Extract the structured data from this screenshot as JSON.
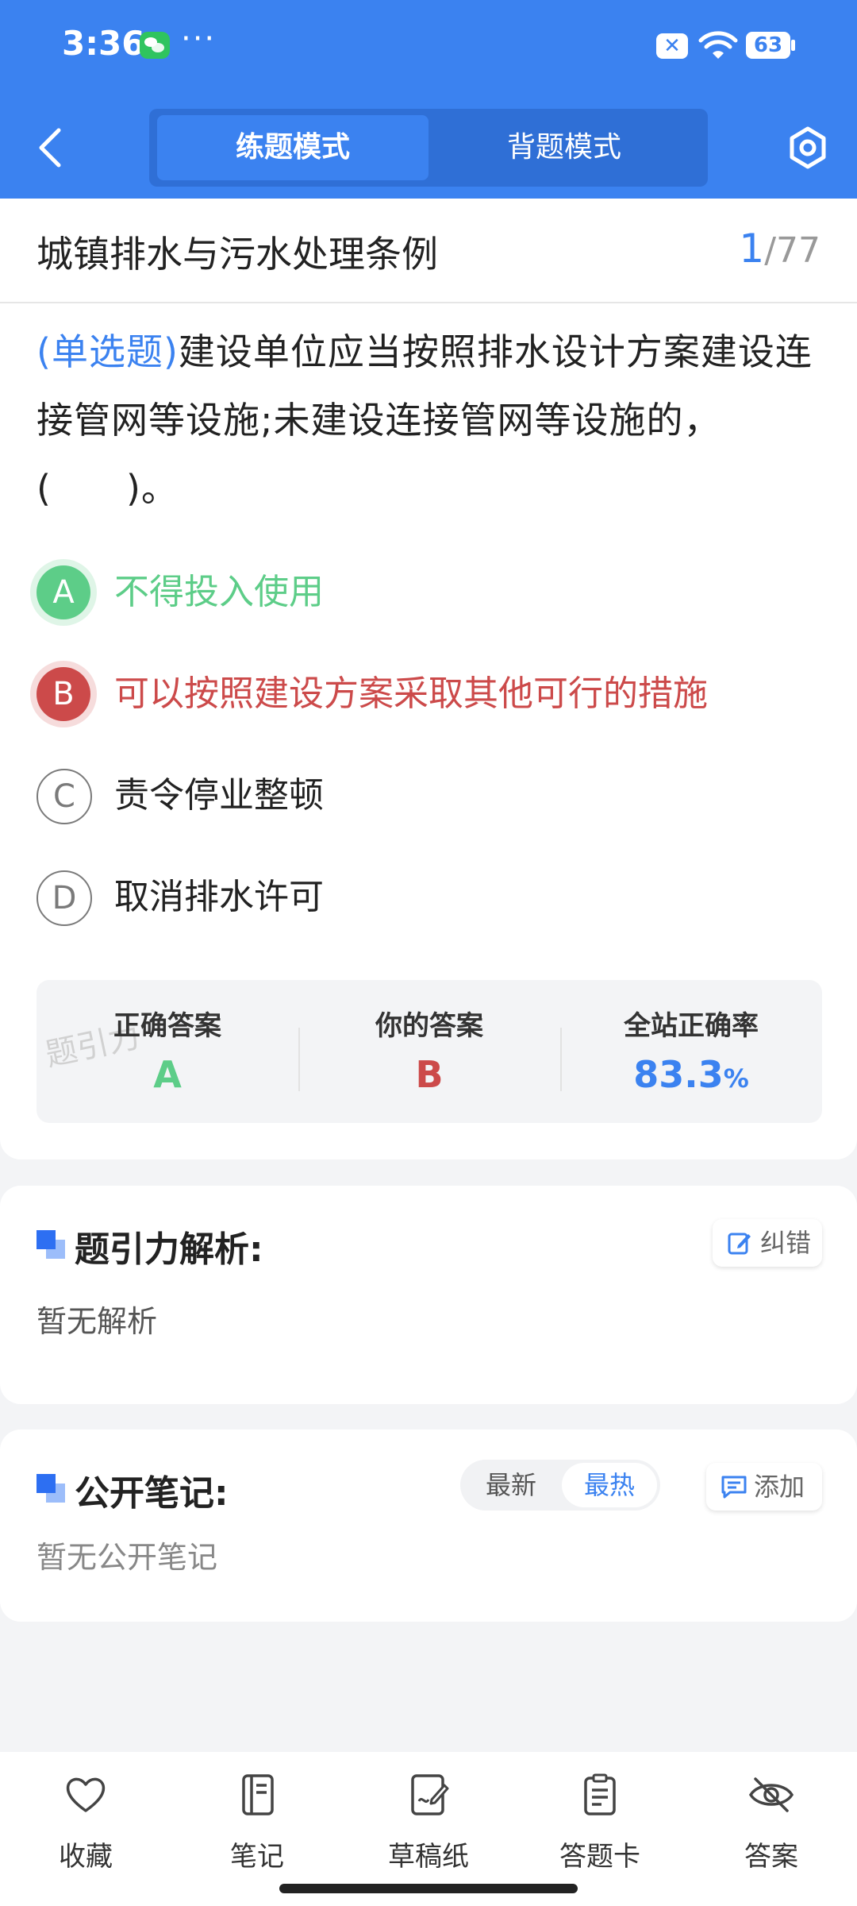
{
  "status_bar": {
    "time": "3:36",
    "dots": "···",
    "battery": "63"
  },
  "header": {
    "tabs": [
      {
        "label": "练题模式",
        "active": true
      },
      {
        "label": "背题模式",
        "active": false
      }
    ]
  },
  "question": {
    "chapter": "城镇排水与污水处理条例",
    "current": "1",
    "total": "/77",
    "type_label": "(单选题)",
    "text": "建设单位应当按照排水设计方案建设连接管网等设施;未建设连接管网等设施的，(　　)。",
    "options": [
      {
        "letter": "A",
        "text": "不得投入使用",
        "state": "correct"
      },
      {
        "letter": "B",
        "text": "可以按照建设方案采取其他可行的措施",
        "state": "wrong"
      },
      {
        "letter": "C",
        "text": "责令停业整顿",
        "state": "plain"
      },
      {
        "letter": "D",
        "text": "取消排水许可",
        "state": "plain"
      }
    ]
  },
  "stats": {
    "correct_label": "正确答案",
    "correct_value": "A",
    "yours_label": "你的答案",
    "yours_value": "B",
    "rate_label": "全站正确率",
    "rate_value": "83.3",
    "rate_unit": "%",
    "watermark": "题引力"
  },
  "analysis": {
    "title": "题引力解析:",
    "body": "暂无解析",
    "correct_button": "纠错"
  },
  "notes": {
    "title": "公开笔记:",
    "body": "暂无公开笔记",
    "sort_latest": "最新",
    "sort_hot": "最热",
    "add_button": "添加"
  },
  "bottom_nav": [
    {
      "label": "收藏",
      "icon": "heart-icon"
    },
    {
      "label": "笔记",
      "icon": "notebook-icon"
    },
    {
      "label": "草稿纸",
      "icon": "draft-icon"
    },
    {
      "label": "答题卡",
      "icon": "answer-card-icon"
    },
    {
      "label": "答案",
      "icon": "eye-off-icon"
    }
  ],
  "colors": {
    "primary": "#3b82f0",
    "correct": "#5dcd88",
    "wrong": "#cc4a4a"
  }
}
